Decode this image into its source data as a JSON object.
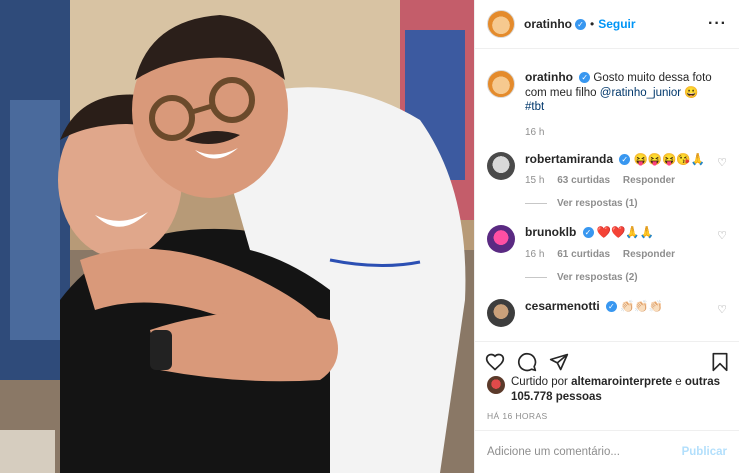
{
  "post": {
    "author": "oratinho",
    "follow_label": "Seguir",
    "more_icon": "more-options-icon"
  },
  "caption": {
    "author": "oratinho",
    "text_before": "Gosto muito dessa foto com meu filho ",
    "mention": "@ratinho_junior",
    "text_after": " 😀",
    "hashtag": "#tbt",
    "time": "16 h"
  },
  "comments": [
    {
      "user": "robertamiranda",
      "text": "😝😝😝😘🙏",
      "time": "15 h",
      "likes": "63 curtidas",
      "reply_label": "Responder",
      "replies": "Ver respostas (1)"
    },
    {
      "user": "brunoklb",
      "text": "❤️❤️🙏🙏",
      "time": "16 h",
      "likes": "61 curtidas",
      "reply_label": "Responder",
      "replies": "Ver respostas (2)"
    },
    {
      "user": "cesarmenotti",
      "text": "👏🏻👏🏻👏🏻"
    }
  ],
  "likes_line": {
    "prefix": "Curtido por ",
    "user": "altemarointerprete",
    "middle": " e ",
    "others": "outras 105.778 pessoas"
  },
  "timestamp": "HÁ 16 HORAS",
  "add_comment": {
    "placeholder": "Adicione um comentário...",
    "publish_label": "Publicar"
  },
  "colors": {
    "accent": "#0095f6",
    "publish_disabled": "#b2dffc",
    "verified": "#3897f0"
  }
}
